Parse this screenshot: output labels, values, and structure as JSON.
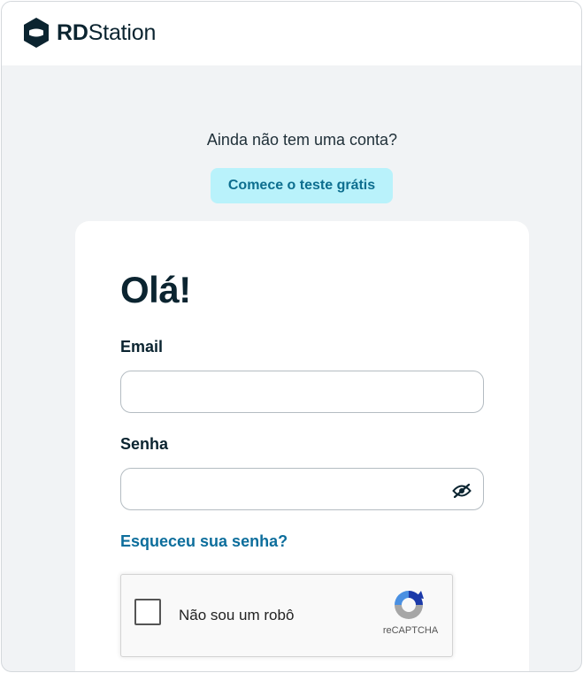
{
  "header": {
    "logo_bold": "RD",
    "logo_light": "Station",
    "logo_icon": "hexagon-logo-icon"
  },
  "signup": {
    "question": "Ainda não tem uma conta?",
    "button_label": "Comece o teste grátis"
  },
  "login": {
    "greeting": "Olá!",
    "email_label": "Email",
    "email_value": "",
    "password_label": "Senha",
    "password_value": "",
    "password_toggle_icon": "eye-off-icon",
    "forgot_link": "Esqueceu sua senha?"
  },
  "recaptcha": {
    "label": "Não sou um robô",
    "brand": "reCAPTCHA",
    "checked": false
  },
  "colors": {
    "accent": "#0d6e9c",
    "trial_button_bg": "#b9f2fb",
    "page_bg": "#f1f3f5",
    "text_dark": "#0b2430"
  }
}
